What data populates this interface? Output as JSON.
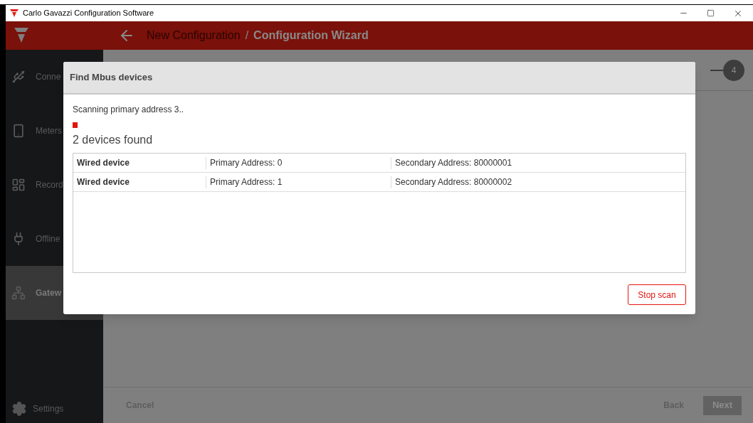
{
  "window": {
    "title": "Carlo Gavazzi Configuration Software"
  },
  "header": {
    "breadcrumb": [
      {
        "label": "New Configuration",
        "selected": false
      },
      {
        "label": "Configuration Wizard",
        "selected": true
      }
    ],
    "separator": "/"
  },
  "sidebar": {
    "items": [
      {
        "kind": "usb",
        "label": "Conne",
        "selected": false
      },
      {
        "kind": "phone",
        "label": "Meters",
        "selected": false
      },
      {
        "kind": "layout",
        "label": "Record",
        "selected": false
      },
      {
        "kind": "plug",
        "label": "Offline",
        "selected": false
      },
      {
        "kind": "network",
        "label": "Gatew",
        "selected": true
      }
    ],
    "settings": "Settings"
  },
  "stepper": {
    "step": "4"
  },
  "footer": {
    "cancel": "Cancel",
    "back": "Back",
    "next": "Next"
  },
  "dialog": {
    "title": "Find Mbus devices",
    "status": "Scanning primary address 3..",
    "found": "2 devices found",
    "rows": [
      {
        "name": "Wired device",
        "primary": "Primary Address: 0",
        "secondary": "Secondary Address: 80000001"
      },
      {
        "name": "Wired device",
        "primary": "Primary Address: 1",
        "secondary": "Secondary Address: 80000002"
      }
    ],
    "button": "Stop scan"
  }
}
